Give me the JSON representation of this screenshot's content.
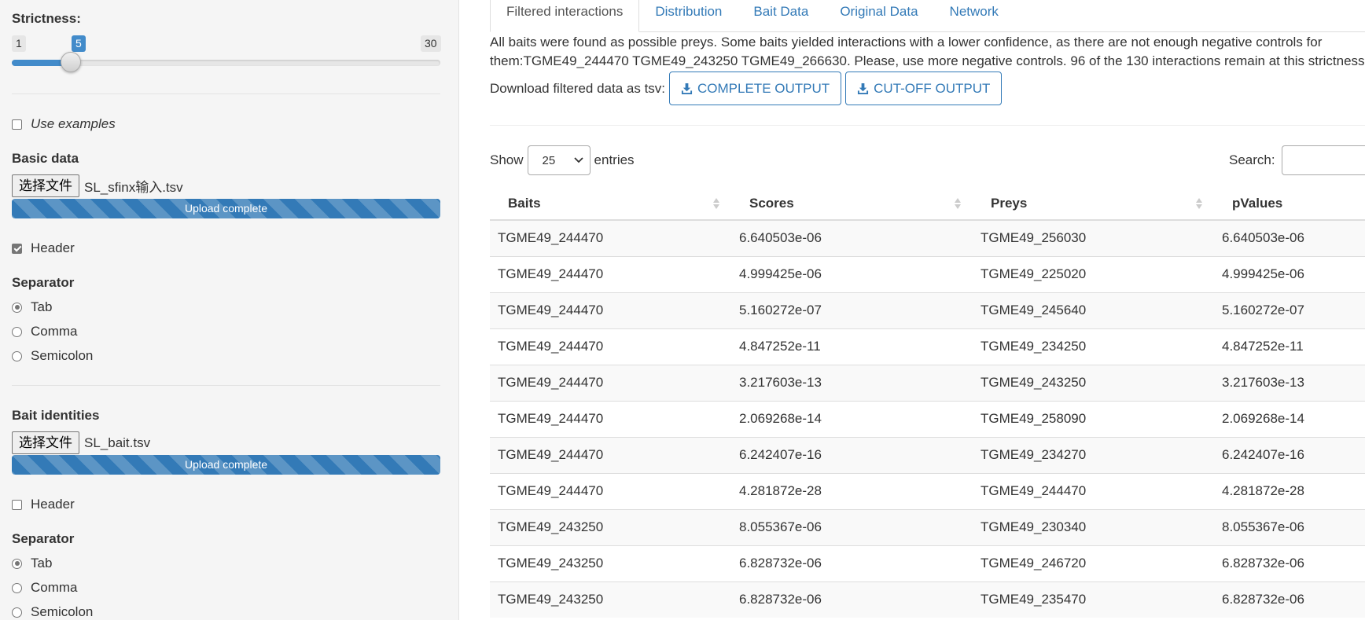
{
  "sidebar": {
    "strictness": {
      "label": "Strictness:",
      "min": "1",
      "max": "30",
      "value": "5"
    },
    "use_examples": {
      "label": "Use examples",
      "checked": false
    },
    "basic_data": {
      "label": "Basic data",
      "file_button": "选择文件",
      "file_name": "SL_sfinx输入.tsv",
      "progress": "Upload complete",
      "header_label": "Header",
      "header_checked": true,
      "separator_label": "Separator",
      "separator_options": [
        "Tab",
        "Comma",
        "Semicolon"
      ],
      "separator_selected": "Tab"
    },
    "bait_identities": {
      "label": "Bait identities",
      "file_button": "选择文件",
      "file_name": "SL_bait.tsv",
      "progress": "Upload complete",
      "header_label": "Header",
      "header_checked": false,
      "separator_label": "Separator",
      "separator_options": [
        "Tab",
        "Comma",
        "Semicolon"
      ],
      "separator_selected": "Tab"
    }
  },
  "main": {
    "tabs": [
      "Filtered interactions",
      "Distribution",
      "Bait Data",
      "Original Data",
      "Network"
    ],
    "active_tab": "Filtered interactions",
    "message_line1": "All baits were found as possible preys. Some baits yielded interactions with a lower confidence, as there are not enough negative controls for",
    "message_line2": "them:TGME49_244470 TGME49_243250 TGME49_266630. Please, use more negative controls. 96 of the 130 interactions remain at this strictness",
    "download_label": "Download filtered data as tsv:",
    "download_complete": "COMPLETE OUTPUT",
    "download_cutoff": "CUT-OFF OUTPUT",
    "show_label": "Show",
    "entries_value": "25",
    "entries_label": "entries",
    "search_label": "Search:",
    "search_value": "",
    "columns": [
      "Baits",
      "Scores",
      "Preys",
      "pValues"
    ],
    "rows": [
      [
        "TGME49_244470",
        "6.640503e-06",
        "TGME49_256030",
        "6.640503e-06"
      ],
      [
        "TGME49_244470",
        "4.999425e-06",
        "TGME49_225020",
        "4.999425e-06"
      ],
      [
        "TGME49_244470",
        "5.160272e-07",
        "TGME49_245640",
        "5.160272e-07"
      ],
      [
        "TGME49_244470",
        "4.847252e-11",
        "TGME49_234250",
        "4.847252e-11"
      ],
      [
        "TGME49_244470",
        "3.217603e-13",
        "TGME49_243250",
        "3.217603e-13"
      ],
      [
        "TGME49_244470",
        "2.069268e-14",
        "TGME49_258090",
        "2.069268e-14"
      ],
      [
        "TGME49_244470",
        "6.242407e-16",
        "TGME49_234270",
        "6.242407e-16"
      ],
      [
        "TGME49_244470",
        "4.281872e-28",
        "TGME49_244470",
        "4.281872e-28"
      ],
      [
        "TGME49_243250",
        "8.055367e-06",
        "TGME49_230340",
        "8.055367e-06"
      ],
      [
        "TGME49_243250",
        "6.828732e-06",
        "TGME49_246720",
        "6.828732e-06"
      ],
      [
        "TGME49_243250",
        "6.828732e-06",
        "TGME49_235470",
        "6.828732e-06"
      ]
    ]
  },
  "colors": {
    "accent": "#337ab7",
    "slider": "#428bca",
    "sidebar_bg": "#f5f5f5"
  },
  "icons": {
    "download": "download-icon",
    "sort": "sort-both-icon",
    "select": "chevron-down-icon"
  }
}
